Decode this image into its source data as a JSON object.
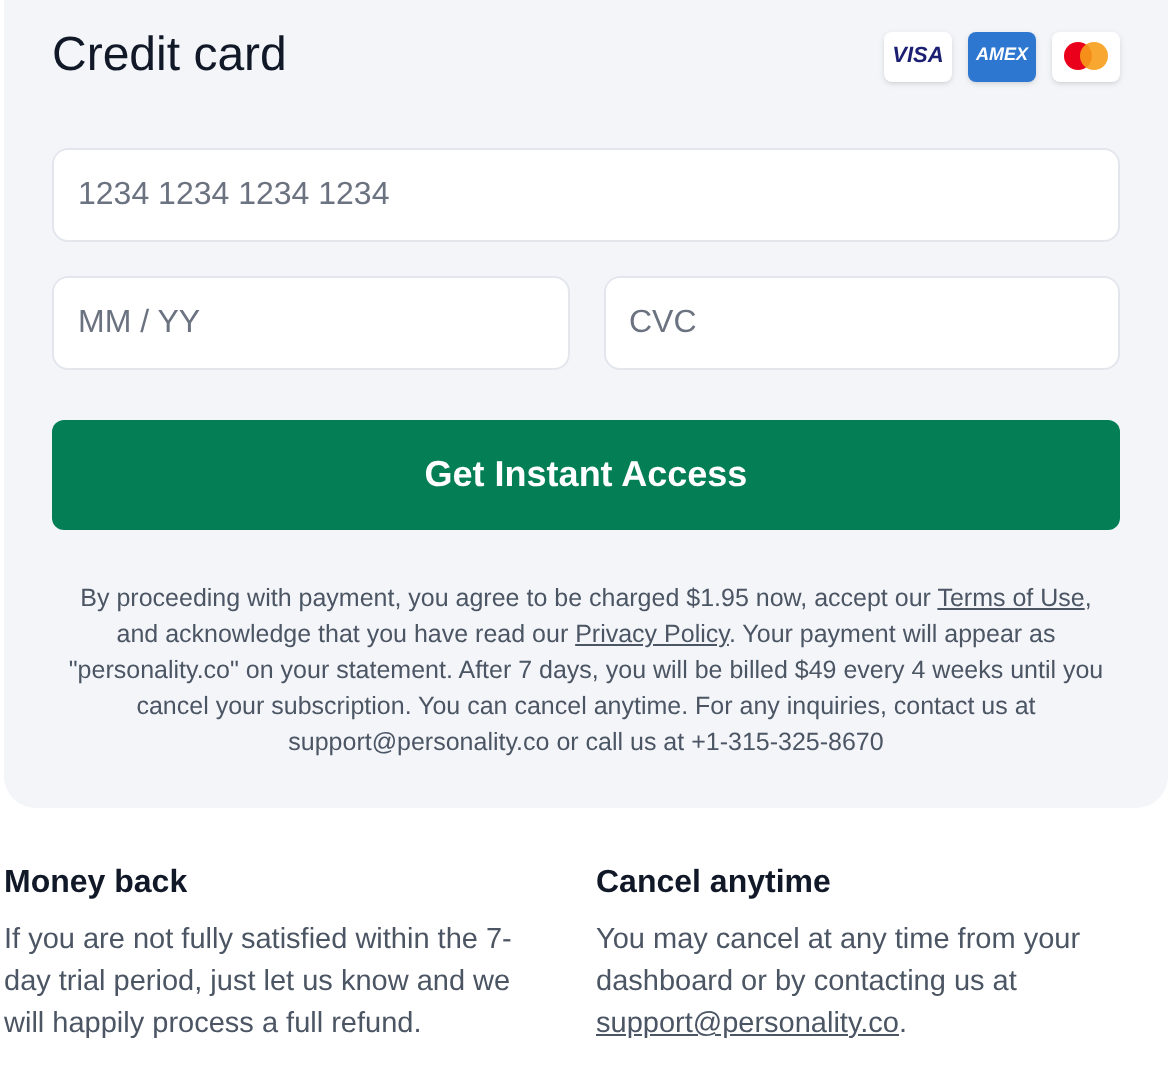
{
  "payment": {
    "title": "Credit card",
    "card_brands": [
      {
        "kind": "visa",
        "label": "VISA"
      },
      {
        "kind": "amex",
        "label": "AMEX"
      },
      {
        "kind": "mastercard"
      }
    ],
    "card_number": {
      "placeholder": "1234 1234 1234 1234"
    },
    "expiry": {
      "placeholder": "MM / YY"
    },
    "cvc": {
      "placeholder": "CVC"
    },
    "submit_button": "Get Instant Access",
    "legal": [
      {
        "kind": "text",
        "text": "By proceeding with payment, you agree to be charged $1.95 now, accept our "
      },
      {
        "kind": "link",
        "text": "Terms of Use"
      },
      {
        "kind": "text",
        "text": ", and acknowledge that you have read our "
      },
      {
        "kind": "link",
        "text": "Privacy Policy"
      },
      {
        "kind": "text",
        "text": ". Your payment will appear as \"personality.co\" on your statement. After 7 days, you will be billed $49 every 4 weeks until you cancel your subscription. You can cancel anytime. For any inquiries, contact us at support@personality.co or call us at +1-315-325-8670"
      }
    ]
  },
  "features": [
    {
      "title": "Money back",
      "body": [
        {
          "kind": "text",
          "text": "If you are not fully satisfied within the 7-day trial period, just let us know and we will happily process a full refund."
        }
      ]
    },
    {
      "title": "Cancel anytime",
      "body": [
        {
          "kind": "text",
          "text": "You may cancel at any time from your dashboard or by contacting us at "
        },
        {
          "kind": "link",
          "text": "support@personality.co"
        },
        {
          "kind": "text",
          "text": "."
        }
      ]
    }
  ]
}
